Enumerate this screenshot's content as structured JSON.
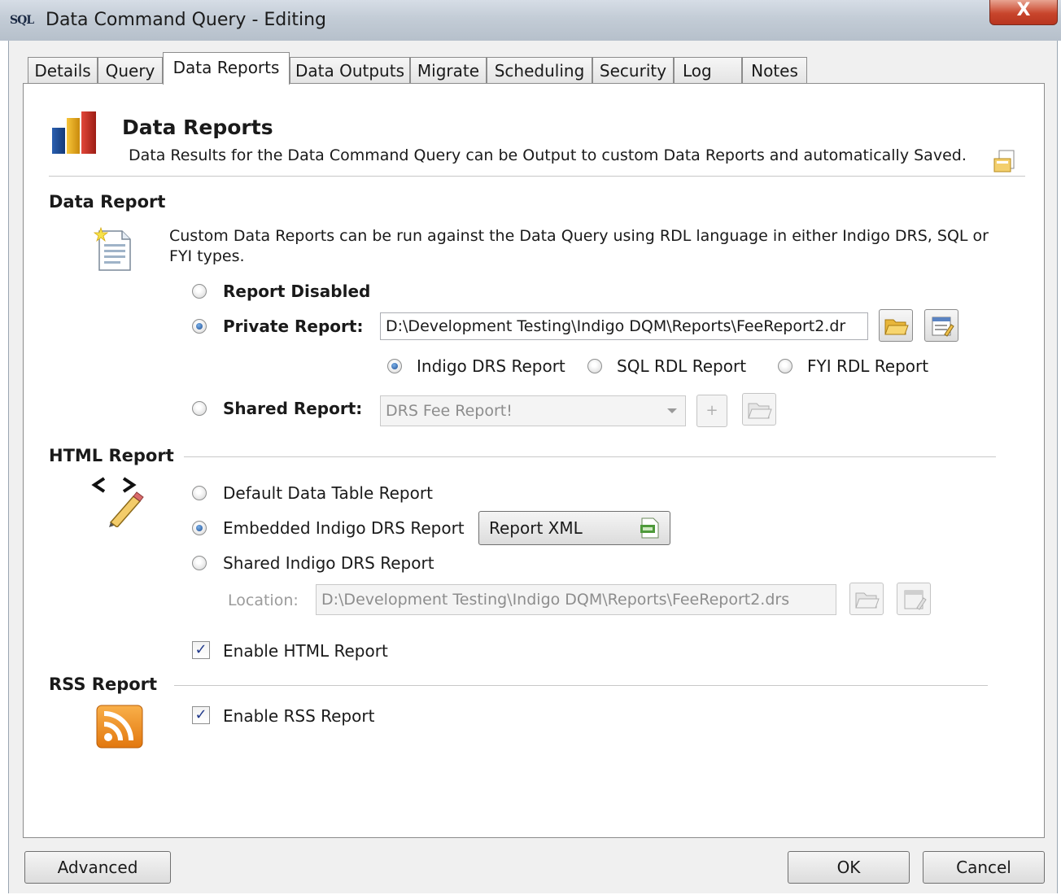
{
  "window": {
    "title": "Data Command Query - Editing",
    "icon_text": "SQL",
    "close_label": "X"
  },
  "tabs": [
    {
      "label": "Details"
    },
    {
      "label": "Query"
    },
    {
      "label": "Data Reports",
      "active": true
    },
    {
      "label": "Data Outputs"
    },
    {
      "label": "Migrate"
    },
    {
      "label": "Scheduling"
    },
    {
      "label": "Security"
    },
    {
      "label": "Log"
    },
    {
      "label": "Notes"
    }
  ],
  "header": {
    "title": "Data Reports",
    "description": "Data Results for the Data Command Query can be Output to custom Data Reports and automatically Saved."
  },
  "data_report": {
    "section_title": "Data Report",
    "description": "Custom Data Reports can be run against the Data Query using RDL language in either Indigo DRS, SQL or FYI types.",
    "options": {
      "disabled_label": "Report Disabled",
      "private_label": "Private Report:",
      "shared_label": "Shared Report:"
    },
    "selected": "Private Report",
    "private_path": "D:\\Development Testing\\Indigo DQM\\Reports\\FeeReport2.dr",
    "report_types": {
      "indigo": "Indigo DRS Report",
      "sql": "SQL RDL Report",
      "fyi": "FYI RDL Report"
    },
    "selected_type": "Indigo DRS Report",
    "shared_value": "DRS Fee Report!",
    "add_label": "+"
  },
  "html_report": {
    "section_title": "HTML Report",
    "options": {
      "default": "Default Data Table Report",
      "embedded": "Embedded Indigo DRS Report",
      "shared": "Shared Indigo DRS Report"
    },
    "selected": "Embedded Indigo DRS Report",
    "report_xml_label": "Report XML",
    "location_label": "Location:",
    "location_value": "D:\\Development Testing\\Indigo DQM\\Reports\\FeeReport2.drs",
    "enable_label": "Enable HTML Report",
    "enabled": true
  },
  "rss_report": {
    "section_title": "RSS Report",
    "enable_label": "Enable RSS Report",
    "enabled": true
  },
  "footer": {
    "advanced_label": "Advanced",
    "ok_label": "OK",
    "cancel_label": "Cancel"
  },
  "icons": {
    "title": "sql-icon",
    "header": "bar-chart-icon",
    "header_right": "save-document-icon",
    "data_report": "document-new-icon",
    "html_report": "html-edit-icon",
    "rss_report": "rss-icon",
    "open": "folder-open-icon",
    "edit": "edit-document-icon",
    "xml": "xml-file-icon"
  },
  "colors": {
    "accent": "#1f4f94",
    "rss": "#f39422",
    "close": "#c8452c"
  }
}
